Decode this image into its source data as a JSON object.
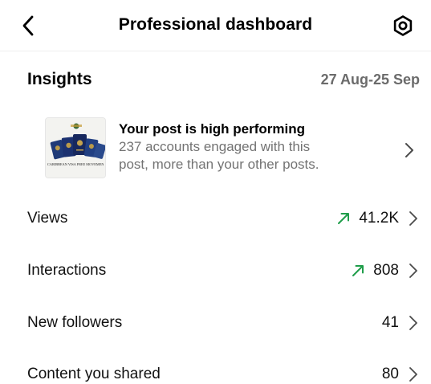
{
  "header": {
    "title": "Professional dashboard",
    "back_icon": "chevron-left-icon",
    "settings_icon": "gear-icon"
  },
  "insights": {
    "title": "Insights",
    "date_range": "27 Aug-25 Sep"
  },
  "post_card": {
    "headline": "Your post is high performing",
    "line1": "237 accounts engaged with this",
    "line2": "post, more than your other posts.",
    "thumbnail_caption": "CARIBBEAN VISA FREE MOVEMENT"
  },
  "metrics": [
    {
      "label": "Views",
      "value": "41.2K",
      "trend": "up"
    },
    {
      "label": "Interactions",
      "value": "808",
      "trend": "up"
    },
    {
      "label": "New followers",
      "value": "41",
      "trend": "none"
    },
    {
      "label": "Content you shared",
      "value": "80",
      "trend": "none"
    }
  ],
  "colors": {
    "trend_up": "#1f9d4a",
    "muted_text": "#737373",
    "chevron": "#4a4a4a"
  }
}
